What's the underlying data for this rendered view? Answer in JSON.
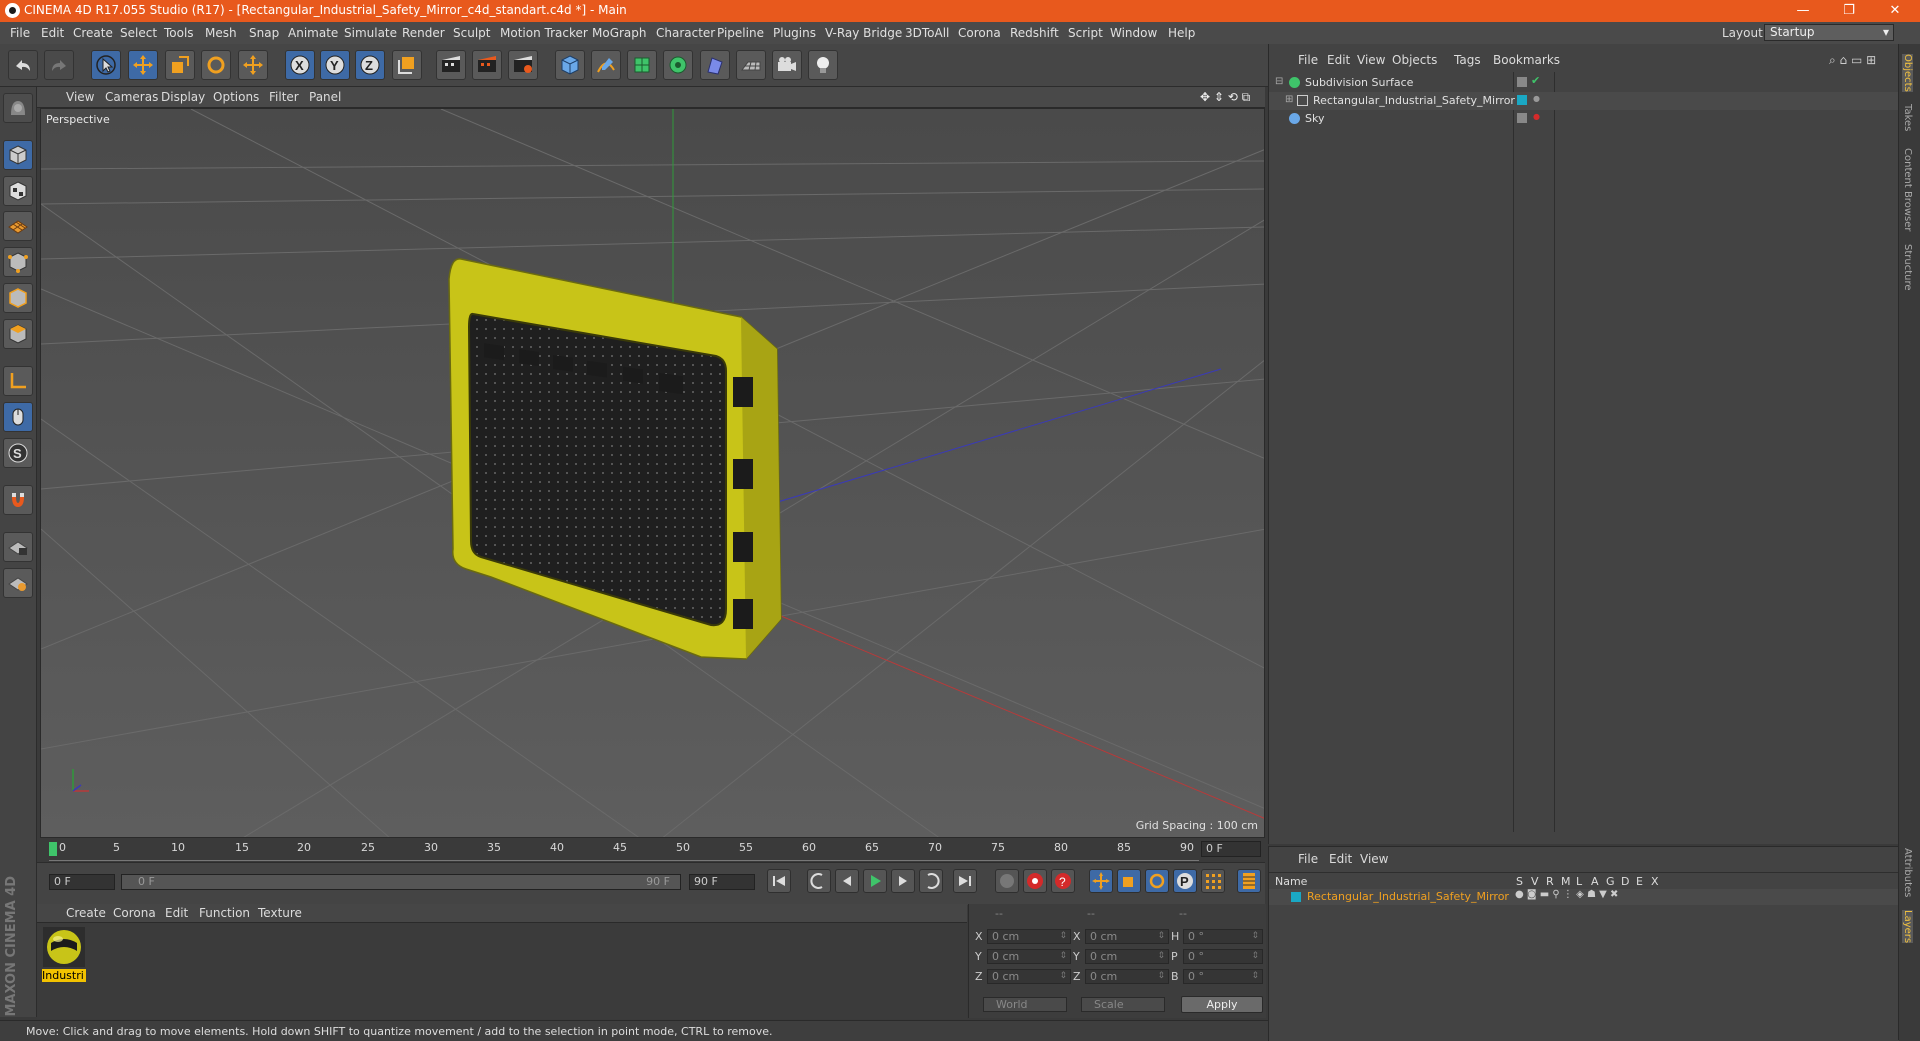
{
  "window": {
    "title": "CINEMA 4D R17.055 Studio (R17) - [Rectangular_Industrial_Safety_Mirror_c4d_standart.c4d *] - Main",
    "min_label": "—",
    "max_label": "❐",
    "close_label": "✕"
  },
  "menubar": {
    "items": [
      "File",
      "Edit",
      "Create",
      "Select",
      "Tools",
      "Mesh",
      "Snap",
      "Animate",
      "Simulate",
      "Render",
      "Sculpt",
      "Motion Tracker",
      "MoGraph",
      "Character",
      "Pipeline",
      "Plugins",
      "V-Ray Bridge",
      "3DToAll",
      "Corona",
      "Redshift",
      "Script",
      "Window",
      "Help"
    ],
    "layout_label": "Layout:",
    "layout_value": "Startup"
  },
  "viewport": {
    "menu": [
      "View",
      "Cameras",
      "Display",
      "Options",
      "Filter",
      "Panel"
    ],
    "label": "Perspective",
    "grid_spacing": "Grid Spacing : 100 cm",
    "axis_colors": {
      "x": "#b83a3a",
      "y": "#2f9a3a",
      "z": "#3a3ab8"
    },
    "object_color": "#d4cf1e"
  },
  "timeline": {
    "ticks": [
      "0",
      "5",
      "10",
      "15",
      "20",
      "25",
      "30",
      "35",
      "40",
      "45",
      "50",
      "55",
      "60",
      "65",
      "70",
      "75",
      "80",
      "85",
      "90"
    ],
    "current_frame": "0 F"
  },
  "playbar": {
    "start_field": "0 F",
    "range_start": "0 F",
    "range_end": "90 F",
    "end_field": "90 F"
  },
  "material_manager": {
    "menu": [
      "Create",
      "Corona",
      "Edit",
      "Function",
      "Texture"
    ],
    "materials": [
      {
        "name": "Industri"
      }
    ]
  },
  "coordinates": {
    "headers": [
      "--",
      "--",
      "--"
    ],
    "rows": [
      {
        "l1": "X",
        "v1": "0 cm",
        "l2": "X",
        "v2": "0 cm",
        "l3": "H",
        "v3": "0 °"
      },
      {
        "l1": "Y",
        "v1": "0 cm",
        "l2": "Y",
        "v2": "0 cm",
        "l3": "P",
        "v3": "0 °"
      },
      {
        "l1": "Z",
        "v1": "0 cm",
        "l2": "Z",
        "v2": "0 cm",
        "l3": "B",
        "v3": "0 °"
      }
    ],
    "space": "World",
    "mode": "Scale",
    "apply": "Apply"
  },
  "object_manager": {
    "menu": [
      "File",
      "Edit",
      "View",
      "Objects",
      "Tags",
      "Bookmarks"
    ],
    "objects": [
      {
        "name": "Subdivision Surface"
      },
      {
        "name": "Rectangular_Industrial_Safety_Mirror"
      },
      {
        "name": "Sky"
      }
    ]
  },
  "layer_manager": {
    "menu": [
      "File",
      "Edit",
      "View"
    ],
    "columns": {
      "name": "Name",
      "s": "S",
      "v": "V",
      "r": "R",
      "m": "M",
      "l": "L",
      "a": "A",
      "g": "G",
      "d": "D",
      "e": "E",
      "x": "X"
    },
    "layers": [
      {
        "name": "Rectangular_Industrial_Safety_Mirror"
      }
    ]
  },
  "right_tabs": [
    "Objects",
    "Takes",
    "Content Browser",
    "Structure",
    "Attributes",
    "Layers"
  ],
  "brand": {
    "vertical_text": "MAXON CINEMA 4D"
  },
  "status": "Move: Click and drag to move elements. Hold down SHIFT to quantize movement / add to the selection in point mode, CTRL to remove."
}
